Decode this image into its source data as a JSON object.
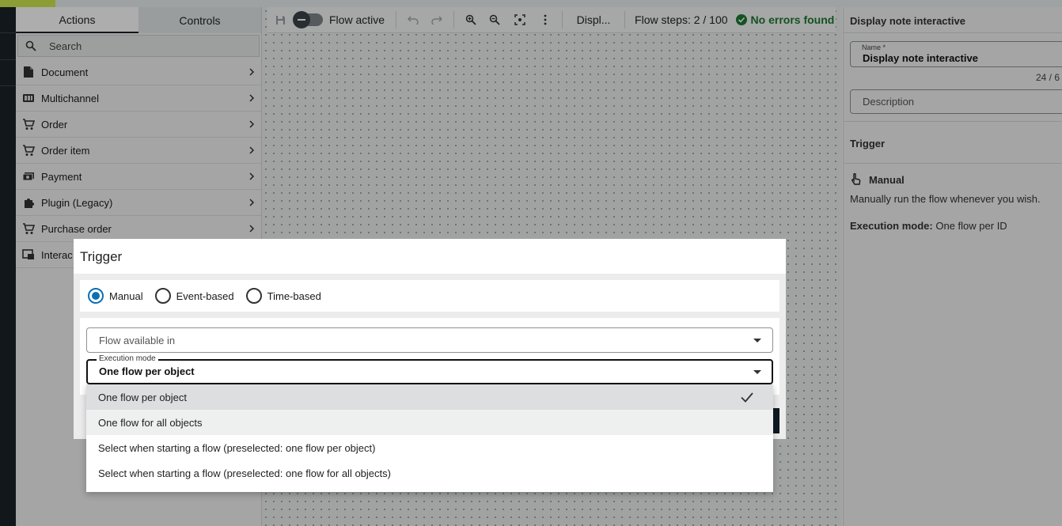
{
  "actions_panel": {
    "tabs": [
      {
        "label": "Actions",
        "active": true
      },
      {
        "label": "Controls",
        "active": false
      }
    ],
    "search_placeholder": "Search",
    "items": [
      {
        "label": "Document",
        "icon": "document-icon"
      },
      {
        "label": "Multichannel",
        "icon": "multichannel-icon"
      },
      {
        "label": "Order",
        "icon": "cart-icon"
      },
      {
        "label": "Order item",
        "icon": "cart-icon"
      },
      {
        "label": "Payment",
        "icon": "payment-icon"
      },
      {
        "label": "Plugin (Legacy)",
        "icon": "puzzle-icon"
      },
      {
        "label": "Purchase order",
        "icon": "cart-icon"
      },
      {
        "label": "Interac",
        "icon": "interaction-icon"
      }
    ]
  },
  "toolbar": {
    "flow_active_label": "Flow active",
    "flow_active_on": false,
    "node_label": "Displ...",
    "flow_steps": "Flow steps: 2 / 100",
    "status": "No errors found",
    "status_color": "#1d7a32"
  },
  "right_panel": {
    "title": "Display note interactive",
    "name_label": "Name *",
    "name_value": "Display note interactive",
    "counter": "24 / 6",
    "description_placeholder": "Description",
    "trigger_heading": "Trigger",
    "trigger_type": "Manual",
    "trigger_description": "Manually run the flow whenever you wish.",
    "execution_mode_label": "Execution mode:",
    "execution_mode_value": "One flow per ID"
  },
  "dialog": {
    "title": "Trigger",
    "radios": [
      {
        "label": "Manual",
        "checked": true
      },
      {
        "label": "Event-based",
        "checked": false
      },
      {
        "label": "Time-based",
        "checked": false
      }
    ],
    "flow_available_placeholder": "Flow available in",
    "execution_mode_label": "Execution mode",
    "execution_mode_value": "One flow per object",
    "accent_color": "#0d6fb3"
  },
  "dropdown": {
    "options": [
      {
        "label": "One flow per object",
        "selected": true
      },
      {
        "label": "One flow for all objects",
        "hovered": true
      },
      {
        "label": "Select when starting a flow (preselected: one flow per object)"
      },
      {
        "label": "Select when starting a flow (preselected: one flow for all objects)"
      }
    ]
  }
}
